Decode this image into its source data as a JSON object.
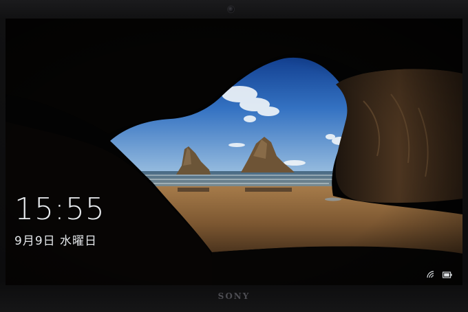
{
  "device": {
    "brand": "SONY"
  },
  "lock_screen": {
    "time": "15:55",
    "date": "9月9日 水曜日",
    "status_icons": [
      "wifi-icon",
      "battery-icon"
    ]
  },
  "colors": {
    "text": "#e9ecef",
    "sky": "#2f66b8",
    "sand": "#8a6034",
    "rock": "#3a2a1c"
  }
}
